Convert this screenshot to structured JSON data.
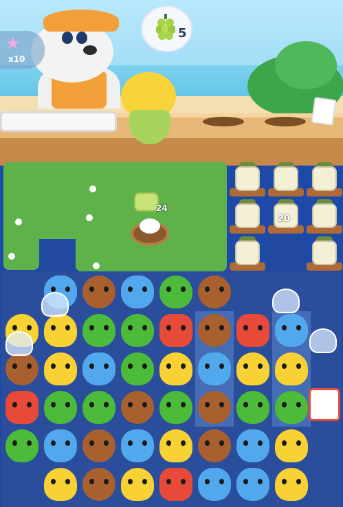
{
  "booster": {
    "icon": "star-icon",
    "count": "x10"
  },
  "goal": {
    "icon": "grape-icon",
    "count": "5"
  },
  "grass_target": {
    "icon": "fish-icon",
    "count": "24"
  },
  "jars": {
    "icon": "fish-jar-icon",
    "count": "20"
  },
  "colors": {
    "hippo": "#52a8ec",
    "bear": "#a8602e",
    "frog": "#4cbb3a",
    "fox": "#e84a3a",
    "chick": "#f8d234"
  },
  "board": [
    [
      "",
      "hippo",
      "bear",
      "hippo",
      "frog",
      "bear",
      "",
      ""
    ],
    [
      "chick",
      "chick",
      "frog",
      "frog",
      "fox",
      "bear",
      "fox",
      "hippo"
    ],
    [
      "bear",
      "chick",
      "hippo",
      "frog",
      "chick",
      "hippo",
      "chick",
      "chick"
    ],
    [
      "fox",
      "frog",
      "frog",
      "bear",
      "frog",
      "bear",
      "frog",
      "frog"
    ],
    [
      "frog",
      "hippo",
      "bear",
      "hippo",
      "chick",
      "bear",
      "hippo",
      "chick"
    ],
    [
      "",
      "chick",
      "bear",
      "chick",
      "fox",
      "hippo",
      "hippo",
      "chick"
    ]
  ]
}
